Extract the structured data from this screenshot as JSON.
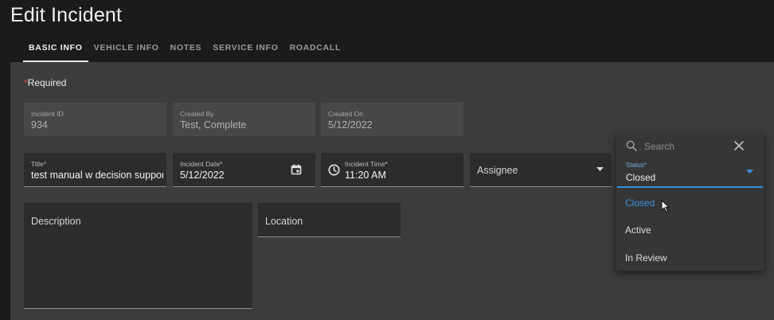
{
  "page": {
    "title": "Edit Incident"
  },
  "tabs": [
    {
      "label": "BASIC INFO",
      "active": true
    },
    {
      "label": "VEHICLE INFO"
    },
    {
      "label": "NOTES"
    },
    {
      "label": "SERVICE INFO"
    },
    {
      "label": "ROADCALL"
    }
  ],
  "form": {
    "required_star": "*",
    "required_text": "Required",
    "incident_id": {
      "label": "Incident ID",
      "value": "934"
    },
    "created_by": {
      "label": "Created By",
      "value": "Test, Complete"
    },
    "created_on": {
      "label": "Created On",
      "value": "5/12/2022"
    },
    "title": {
      "label": "Title*",
      "value": "test manual w decision suppor"
    },
    "incident_date": {
      "label": "Incident Date*",
      "value": "5/12/2022",
      "icon": "calendar-icon"
    },
    "incident_time": {
      "label": "Incident Time*",
      "value": "11:20 AM",
      "icon": "clock-icon"
    },
    "assignee": {
      "placeholder": "Assignee"
    },
    "description": {
      "placeholder": "Description"
    },
    "location": {
      "placeholder": "Location"
    }
  },
  "status_dropdown": {
    "search_placeholder": "Search",
    "label": "Status*",
    "value": "Closed",
    "options": [
      {
        "label": "Closed",
        "selected": true
      },
      {
        "label": "Active"
      },
      {
        "label": "In Review"
      }
    ]
  },
  "colors": {
    "accent": "#3a8fdc",
    "required_star": "#d9534f",
    "panel": "#3c3c3c",
    "background": "#1b1b1b"
  }
}
